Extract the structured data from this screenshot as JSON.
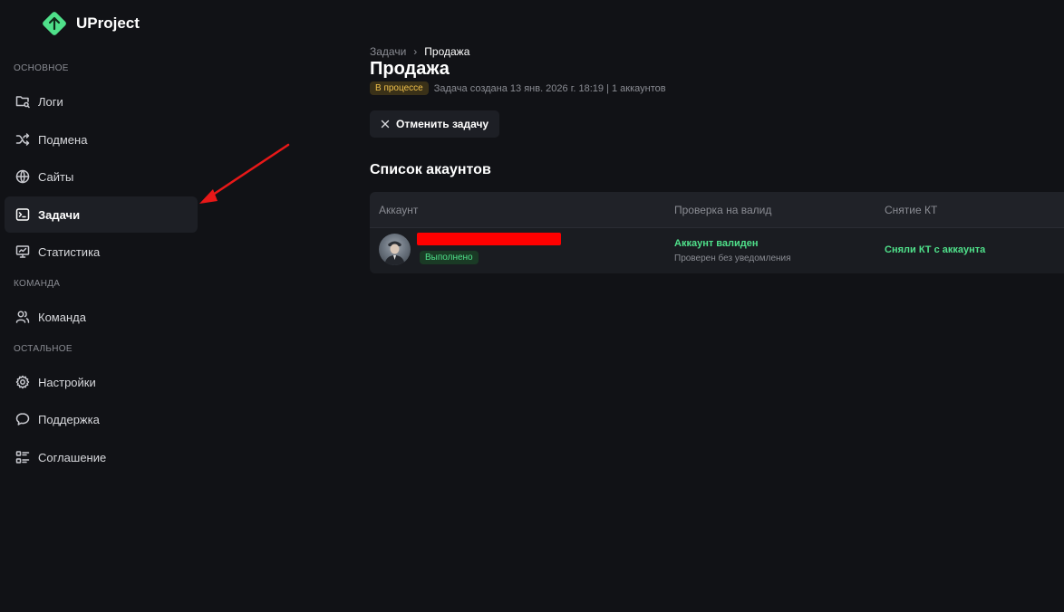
{
  "app": {
    "name": "UProject",
    "accent": "#4fe08a"
  },
  "sidebar": {
    "sections": [
      {
        "title": "ОСНОВНОЕ"
      },
      {
        "title": "КОМАНДА"
      },
      {
        "title": "ОСТАЛЬНОЕ"
      }
    ],
    "items": [
      {
        "label": "Логи",
        "icon": "folder-icon"
      },
      {
        "label": "Подмена",
        "icon": "shuffle-icon"
      },
      {
        "label": "Сайты",
        "icon": "globe-icon"
      },
      {
        "label": "Задачи",
        "icon": "terminal-icon",
        "active": true
      },
      {
        "label": "Статистика",
        "icon": "monitor-icon"
      },
      {
        "label": "Команда",
        "icon": "users-icon"
      },
      {
        "label": "Настройки",
        "icon": "gear-icon"
      },
      {
        "label": "Поддержка",
        "icon": "chat-icon"
      },
      {
        "label": "Соглашение",
        "icon": "list-icon"
      }
    ]
  },
  "main": {
    "breadcrumb": {
      "parent": "Задачи",
      "current": "Продажа"
    },
    "title": "Продажа",
    "status": "В процессе",
    "meta": "Задача создана 13 янв. 2026 г. 18:19 | 1 аккаунтов",
    "cancel_label": "Отменить задачу",
    "list_title": "Список акаунтов",
    "table": {
      "headers": [
        "Аккаунт",
        "Проверка на валид",
        "Снятие КТ"
      ],
      "rows": [
        {
          "status": "Выполнено",
          "valid_title": "Аккаунт валиден",
          "valid_sub": "Проверен без уведомления",
          "kt": "Сняли КТ с аккаунта"
        }
      ]
    }
  }
}
